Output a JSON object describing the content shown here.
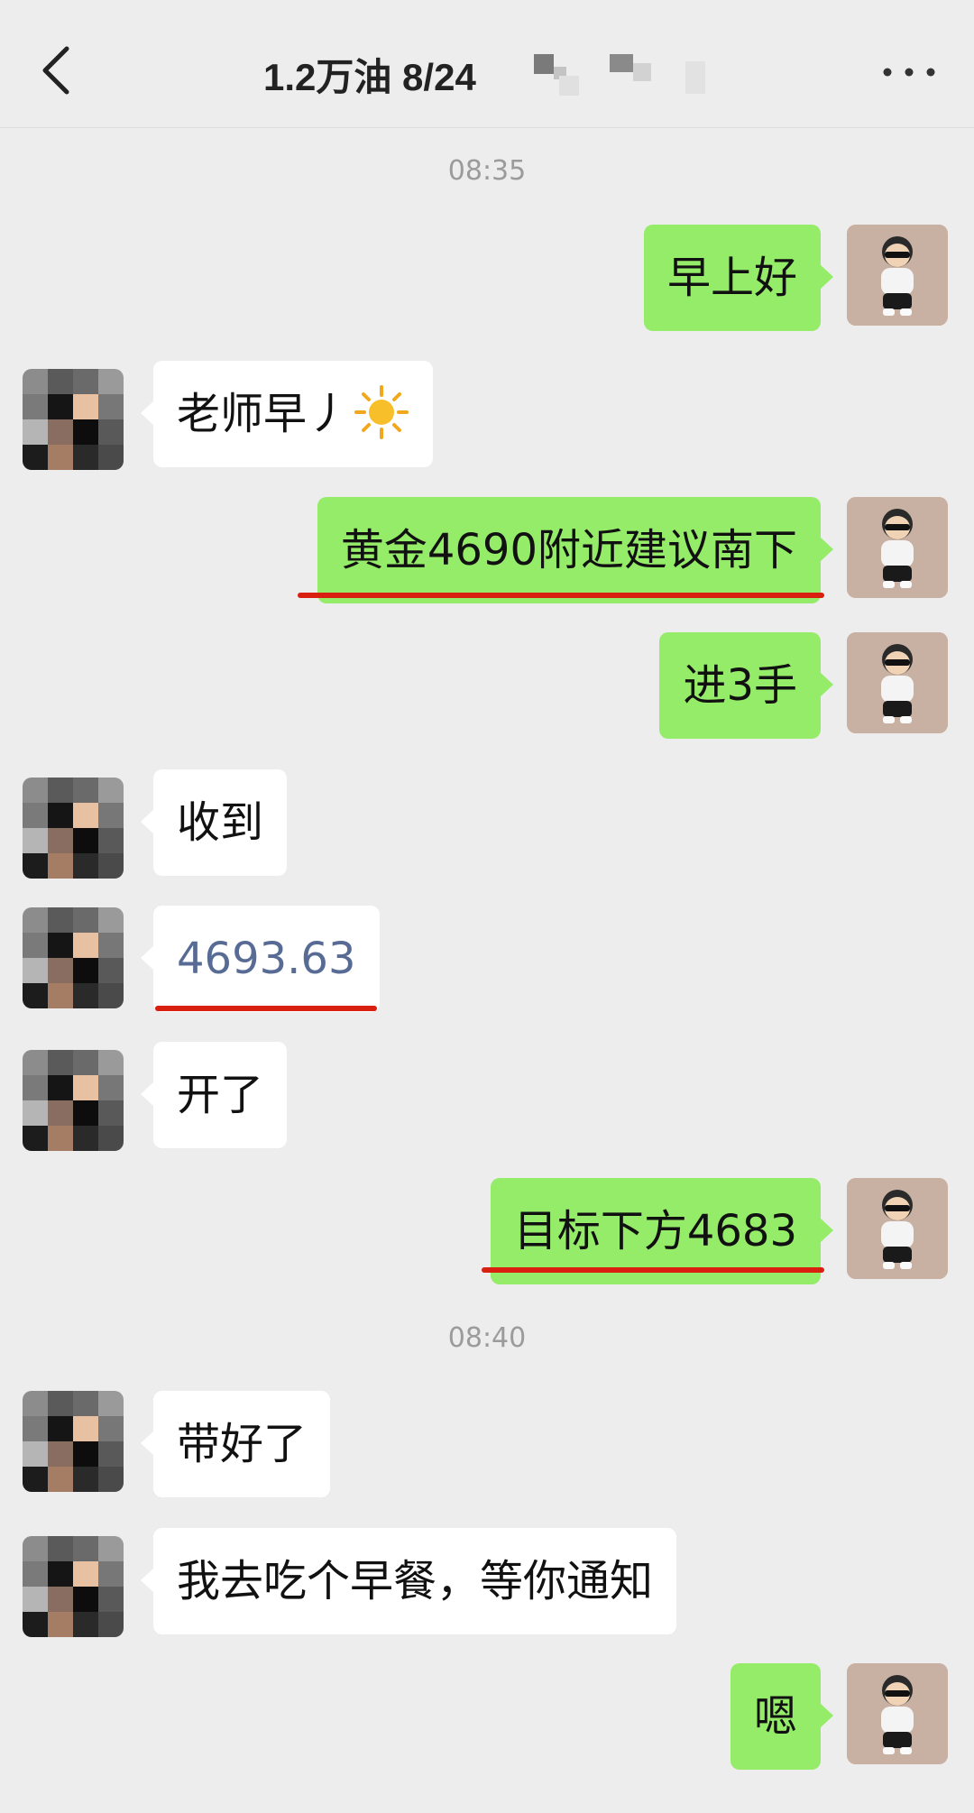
{
  "header": {
    "title": "1.2万油  8/24",
    "back_icon": "chevron-left-icon",
    "more_icon": "more-horizontal-icon"
  },
  "timestamps": [
    "08:35",
    "08:40"
  ],
  "messages": [
    {
      "sender": "me",
      "text": "早上好"
    },
    {
      "sender": "them",
      "text": "老师早丿",
      "emoji": "sun-icon"
    },
    {
      "sender": "me",
      "text": "黄金4690附近建议南下",
      "underlined": true
    },
    {
      "sender": "me",
      "text": "进3手"
    },
    {
      "sender": "them",
      "text": "收到"
    },
    {
      "sender": "them",
      "text": "4693.63",
      "style": "link",
      "underlined": true
    },
    {
      "sender": "them",
      "text": "开了"
    },
    {
      "sender": "me",
      "text": "目标下方4683",
      "underlined": true
    },
    {
      "sender": "them",
      "text": "带好了"
    },
    {
      "sender": "them",
      "text": "我去吃个早餐，等你通知"
    },
    {
      "sender": "me",
      "text": "嗯"
    }
  ],
  "colors": {
    "background": "#ededed",
    "bubble_me": "#95ec69",
    "bubble_them": "#ffffff",
    "link": "#576b95",
    "underline": "#d81f10",
    "timestamp": "#9b9b9b"
  }
}
